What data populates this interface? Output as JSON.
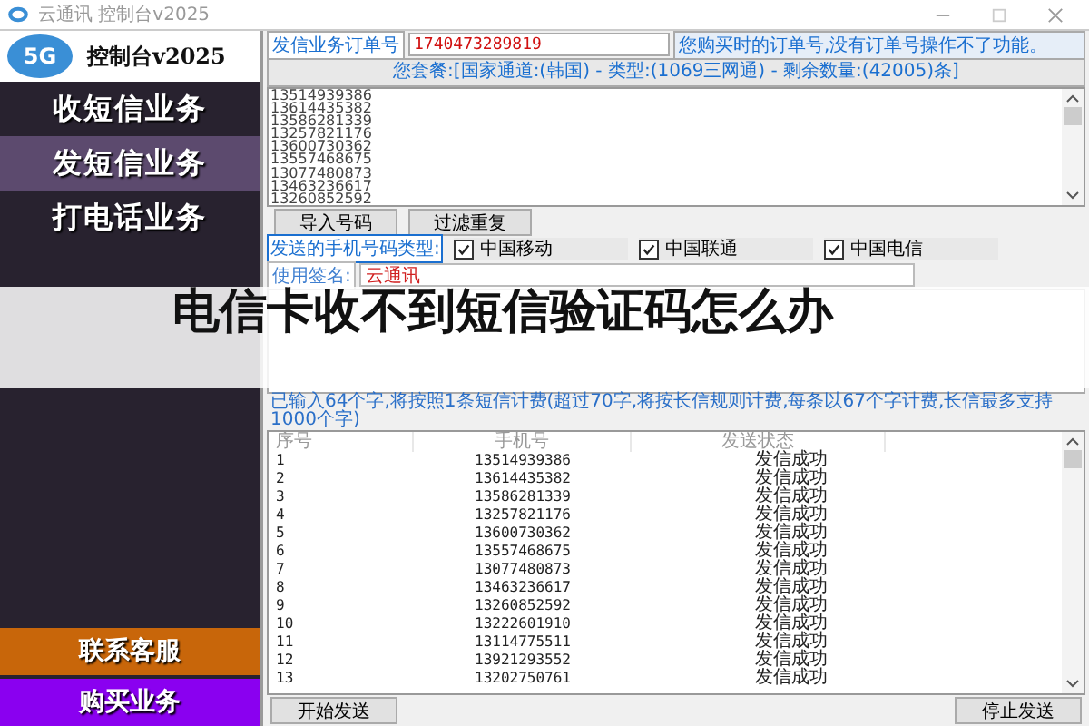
{
  "window": {
    "title": "云通讯 控制台v2025"
  },
  "sidebar": {
    "logo_badge": "5G",
    "logo_title": "控制台v2025",
    "items": [
      {
        "label": "收短信业务",
        "selected": false
      },
      {
        "label": "发短信业务",
        "selected": true
      },
      {
        "label": "打电话业务",
        "selected": false
      }
    ],
    "bottom_buttons": [
      {
        "label": "联系客服",
        "color": "#c8660a"
      },
      {
        "label": "购买业务",
        "color": "#8a00f0"
      }
    ]
  },
  "order": {
    "label": "发信业务订单号",
    "value": "1740473289819",
    "hint": "您购买时的订单号,没有订单号操作不了功能。"
  },
  "package_info": "您套餐:[国家通道:(韩国) - 类型:(1069三网通) - 剩余数量:(42005)条]",
  "numbers_input": {
    "lines": [
      "13514939386",
      "13614435382",
      "13586281339",
      "13257821176",
      "13600730362",
      "13557468675",
      "13077480873",
      "13463236617",
      "13260852592"
    ]
  },
  "number_buttons": [
    "导入号码",
    "过滤重复"
  ],
  "carrier_filter": {
    "label": "发送的手机号码类型:",
    "options": [
      {
        "label": "中国移动",
        "checked": true
      },
      {
        "label": "中国联通",
        "checked": true
      },
      {
        "label": "中国电信",
        "checked": true
      }
    ]
  },
  "signature": {
    "label": "使用签名:",
    "value": "云通讯"
  },
  "char_count_note": "已输入64个字,将按照1条短信计费(超过70字,将按长信规则计费,每条以67个字计费,长信最多支持1000个字)",
  "results_table": {
    "columns": [
      "序号",
      "手机号",
      "发送状态"
    ],
    "rows": [
      [
        "1",
        "13514939386",
        "发信成功"
      ],
      [
        "2",
        "13614435382",
        "发信成功"
      ],
      [
        "3",
        "13586281339",
        "发信成功"
      ],
      [
        "4",
        "13257821176",
        "发信成功"
      ],
      [
        "5",
        "13600730362",
        "发信成功"
      ],
      [
        "6",
        "13557468675",
        "发信成功"
      ],
      [
        "7",
        "13077480873",
        "发信成功"
      ],
      [
        "8",
        "13463236617",
        "发信成功"
      ],
      [
        "9",
        "13260852592",
        "发信成功"
      ],
      [
        "10",
        "13222601910",
        "发信成功"
      ],
      [
        "11",
        "13114775511",
        "发信成功"
      ],
      [
        "12",
        "13921293552",
        "发信成功"
      ],
      [
        "13",
        "13202750761",
        "发信成功"
      ]
    ]
  },
  "action_buttons": [
    "开始发送",
    "停止发送"
  ],
  "overlay_title": "电信卡收不到短信验证码怎么办"
}
